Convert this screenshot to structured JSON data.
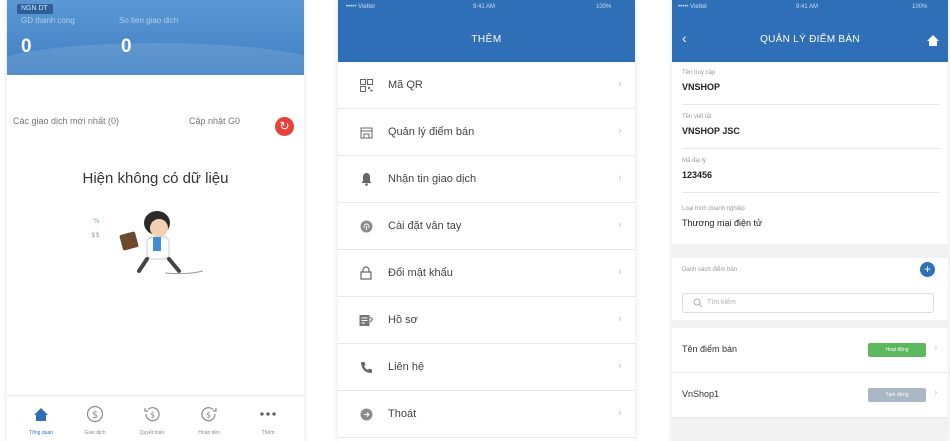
{
  "colors": {
    "primary": "#2e6fb8",
    "danger": "#e8413a",
    "success": "#5cb85c",
    "inactive": "#aab7c4"
  },
  "overview": {
    "badge": "NGN DT",
    "stats": [
      {
        "label": "GD thanh cong",
        "value": "0"
      },
      {
        "label": "So tien giao dich",
        "value": "0"
      }
    ],
    "latest_label": "Các giao dịch mới nhất (0)",
    "update_label": "Cập nhật G0",
    "empty_text": "Hiện không có dữ liệu",
    "tabs": [
      {
        "icon": "home-icon",
        "label": "Tổng quan",
        "active": true
      },
      {
        "icon": "dollar-icon",
        "label": "Giao dịch",
        "active": false
      },
      {
        "icon": "history-icon",
        "label": "Quyết toán",
        "active": false
      },
      {
        "icon": "refund-icon",
        "label": "Hoàn tiền",
        "active": false
      },
      {
        "icon": "more-icon",
        "label": "Thêm",
        "active": false
      }
    ]
  },
  "more_menu": {
    "status": {
      "carrier": "••••• Viettel",
      "time": "9:41 AM",
      "battery": "100%"
    },
    "title": "THÊM",
    "items": [
      {
        "icon": "qr-code-icon",
        "label": "Mã QR"
      },
      {
        "icon": "store-icon",
        "label": "Quản lý điểm bán"
      },
      {
        "icon": "notification-icon",
        "label": "Nhận tin giao dịch"
      },
      {
        "icon": "fingerprint-icon",
        "label": "Cài đặt vân tay"
      },
      {
        "icon": "lock-icon",
        "label": "Đổi mật khẩu"
      },
      {
        "icon": "profile-icon",
        "label": "Hồ sơ"
      },
      {
        "icon": "phone-icon",
        "label": "Liên hệ"
      },
      {
        "icon": "logout-icon",
        "label": "Thoát"
      }
    ]
  },
  "store_mgmt": {
    "status": {
      "carrier": "••••• Viettel",
      "time": "9:41 AM",
      "battery": "100%"
    },
    "title": "QUẢN LÝ ĐIỂM BÁN",
    "fields": [
      {
        "label": "Tên truy cập",
        "value": "VNSHOP"
      },
      {
        "label": "Tên viết tắt",
        "value": "VNSHOP JSC"
      },
      {
        "label": "Mã đại lý",
        "value": "123456"
      },
      {
        "label": "Loại hình doanh nghiệp",
        "value": "Thương mại điện tử"
      }
    ],
    "list_title": "Danh sách điểm bán",
    "search_placeholder": "Tìm kiếm",
    "stores": [
      {
        "name": "Tên điểm bán",
        "status": "Hoạt động",
        "active": true
      },
      {
        "name": "VnShop1",
        "status": "Tạm dừng",
        "active": false
      }
    ]
  }
}
